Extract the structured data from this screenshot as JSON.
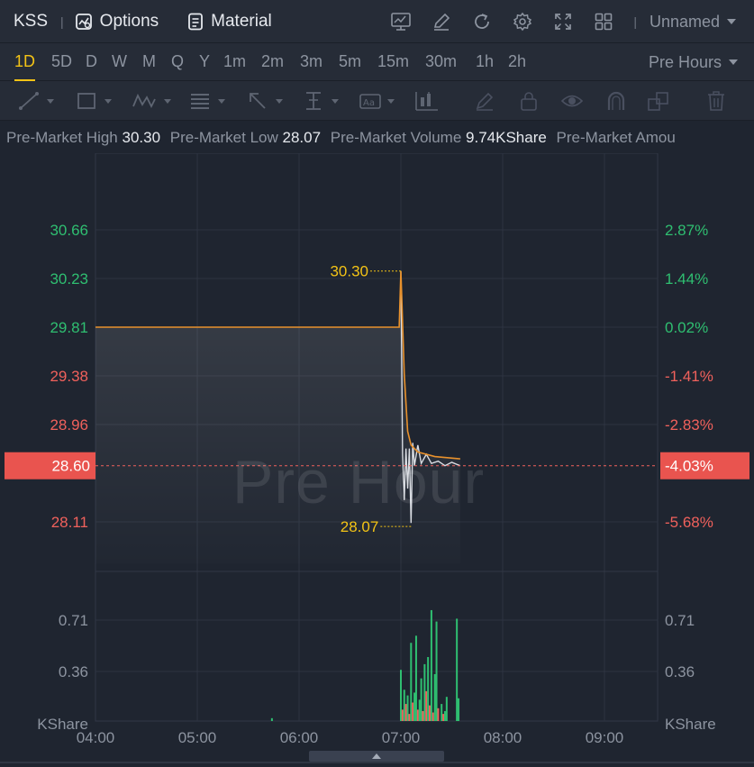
{
  "header": {
    "symbol": "KSS",
    "separator": "|",
    "options_label": "Options",
    "material_label": "Material",
    "layout_name": "Unnamed",
    "icons": [
      "chart-indicator-icon",
      "pen-edit-icon",
      "refresh-icon",
      "settings-gear-icon",
      "fullscreen-icon",
      "grid-layout-icon"
    ]
  },
  "timeframes": {
    "items": [
      "1D",
      "5D",
      "D",
      "W",
      "M",
      "Q",
      "Y",
      "1m",
      "2m",
      "3m",
      "5m",
      "15m",
      "30m",
      "1h",
      "2h"
    ],
    "active": "1D",
    "session_select": "Pre Hours"
  },
  "drawing_tools": [
    "line-tool-icon",
    "rectangle-tool-icon",
    "pattern-tool-icon",
    "fib-tool-icon",
    "arrow-tool-icon",
    "measure-tool-icon",
    "text-tool-icon",
    "candle-tool-icon",
    "brush-icon",
    "lock-icon",
    "eye-icon",
    "magnet-icon",
    "layers-icon",
    "trash-icon"
  ],
  "info": {
    "high_label": "Pre-Market High",
    "high_value": "30.30",
    "low_label": "Pre-Market Low",
    "low_value": "28.07",
    "volume_label": "Pre-Market Volume",
    "volume_value": "9.74KShare",
    "amount_label": "Pre-Market Amou"
  },
  "watermark": "Pre Hour",
  "colors": {
    "up": "#2fbf71",
    "down": "#f0615c",
    "price_line": "#e8912c",
    "accent": "#f3c316",
    "last_price_bg": "#e9544f"
  },
  "chart_data": {
    "type": "line",
    "price_axis_left": [
      "30.66",
      "30.23",
      "29.81",
      "29.38",
      "28.96",
      "28.11"
    ],
    "price_axis_right": [
      "2.87%",
      "1.44%",
      "0.02%",
      "-1.41%",
      "-2.83%",
      "-5.68%"
    ],
    "price_values": [
      30.66,
      30.23,
      29.81,
      29.38,
      28.96,
      28.11
    ],
    "last_price": "28.60",
    "last_change": "-4.03%",
    "high_marker": "30.30",
    "low_marker": "28.07",
    "volume_axis": [
      "0.71",
      "0.36"
    ],
    "volume_unit": "KShare",
    "x_ticks": [
      "04:00",
      "05:00",
      "06:00",
      "07:00",
      "08:00",
      "09:00"
    ],
    "avg_price_series": [
      [
        "04:00",
        29.81
      ],
      [
        "06:59",
        29.81
      ],
      [
        "07:00",
        30.3
      ],
      [
        "07:02",
        29.4
      ],
      [
        "07:04",
        28.9
      ],
      [
        "07:06",
        28.78
      ],
      [
        "07:10",
        28.72
      ],
      [
        "07:20",
        28.68
      ],
      [
        "07:35",
        28.66
      ]
    ],
    "price_series": [
      [
        "07:00",
        30.3
      ],
      [
        "07:01",
        28.7
      ],
      [
        "07:02",
        28.3
      ],
      [
        "07:03",
        28.75
      ],
      [
        "07:04",
        28.4
      ],
      [
        "07:05",
        28.75
      ],
      [
        "07:06",
        28.1
      ],
      [
        "07:07",
        28.8
      ],
      [
        "07:08",
        28.6
      ],
      [
        "07:10",
        28.78
      ],
      [
        "07:12",
        28.62
      ],
      [
        "07:15",
        28.7
      ],
      [
        "07:18",
        28.62
      ],
      [
        "07:22",
        28.64
      ],
      [
        "07:26",
        28.6
      ],
      [
        "07:30",
        28.63
      ],
      [
        "07:35",
        28.6
      ]
    ],
    "volume_bars": [
      [
        "05:44",
        0.02,
        "up"
      ],
      [
        "07:00",
        0.36,
        "up"
      ],
      [
        "07:01",
        0.08,
        "down"
      ],
      [
        "07:02",
        0.22,
        "up"
      ],
      [
        "07:03",
        0.12,
        "down"
      ],
      [
        "07:04",
        0.18,
        "up"
      ],
      [
        "07:05",
        0.05,
        "down"
      ],
      [
        "07:06",
        0.55,
        "up"
      ],
      [
        "07:07",
        0.13,
        "down"
      ],
      [
        "07:08",
        0.2,
        "up"
      ],
      [
        "07:09",
        0.6,
        "up"
      ],
      [
        "07:10",
        0.08,
        "down"
      ],
      [
        "07:11",
        0.15,
        "up"
      ],
      [
        "07:12",
        0.3,
        "up"
      ],
      [
        "07:13",
        0.07,
        "down"
      ],
      [
        "07:14",
        0.4,
        "up"
      ],
      [
        "07:15",
        0.21,
        "down"
      ],
      [
        "07:16",
        0.45,
        "up"
      ],
      [
        "07:17",
        0.11,
        "down"
      ],
      [
        "07:18",
        0.78,
        "up"
      ],
      [
        "07:19",
        0.06,
        "down"
      ],
      [
        "07:20",
        0.33,
        "up"
      ],
      [
        "07:21",
        0.7,
        "up"
      ],
      [
        "07:22",
        0.09,
        "down"
      ],
      [
        "07:24",
        0.12,
        "up"
      ],
      [
        "07:25",
        0.05,
        "down"
      ],
      [
        "07:26",
        0.07,
        "up"
      ],
      [
        "07:27",
        0.17,
        "up"
      ],
      [
        "07:33",
        0.72,
        "up"
      ],
      [
        "07:34",
        0.16,
        "up"
      ]
    ]
  }
}
